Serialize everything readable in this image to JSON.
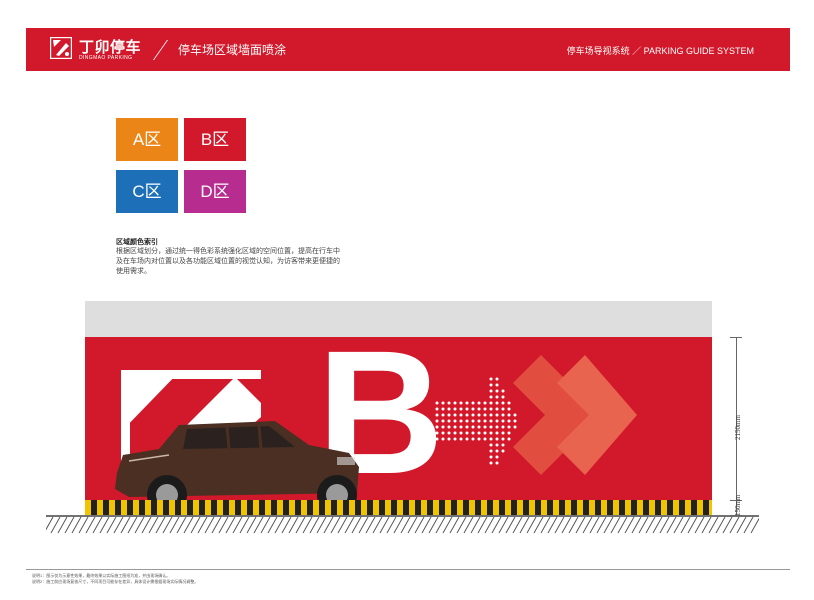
{
  "header": {
    "brand_cn": "丁卯停车",
    "brand_en": "DINGMAO PARKING",
    "title": "停车场区域墙面喷涂",
    "system": "停车场导视系统 ／ PARKING GUIDE SYSTEM"
  },
  "zones": [
    {
      "label": "A区",
      "color": "#ec8517"
    },
    {
      "label": "B区",
      "color": "#d2192b"
    },
    {
      "label": "C区",
      "color": "#1d70b7"
    },
    {
      "label": "D区",
      "color": "#b62d8f"
    }
  ],
  "description": {
    "title": "区域颜色索引",
    "body": "根据区域划分，通过统一得色彩系统强化区域的空间位置，提高在行车中及在车场内对位置以及各功能区域位置的视觉认知，为访客带来更便捷的使用需求。"
  },
  "elevation": {
    "zone_letter": "B",
    "dim_upper": "2150mm",
    "dim_lower": "150mm"
  },
  "footer": {
    "note1": "说明1：图示仅为示意性效果，最终效果以实际施工图纸为准，并由现场确认。",
    "note2": "说明2：施工前应现场复核尺寸，不同项目可能存在差异，具体设计需根据现场实际情况调整。"
  },
  "colors": {
    "brand_red": "#d2192b",
    "safety_yellow": "#f1c400",
    "wall_top_gray": "#dedede"
  }
}
